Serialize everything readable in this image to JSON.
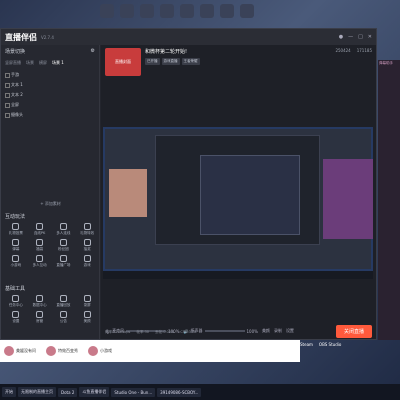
{
  "app": {
    "title": "直播伴侣",
    "version": "V2.7.4"
  },
  "sidebar": {
    "scene_header": "场景切换",
    "tabs": [
      "竖屏直播",
      "场景",
      "横屏",
      "场景 1"
    ],
    "sources": [
      "手游",
      "文本 1",
      "文本 2",
      "全屏",
      "摄像头"
    ],
    "add_source": "+ 添加素材",
    "interact_title": "互动玩法",
    "interact_items": [
      "礼物投票",
      "连线PK",
      "多人连线",
      "礼物特效",
      "弹幕",
      "福袋",
      "粉丝团",
      "抽奖",
      "小游戏",
      "多人互动",
      "直播广场",
      "游戏"
    ],
    "tools_title": "基础工具",
    "tools_items": [
      "任务中心",
      "数据中心",
      "直播回放",
      "录屏",
      "设置",
      "房管",
      "公告",
      "美颜"
    ],
    "more": "更多应用"
  },
  "room": {
    "title": "和微杯第二轮开始!",
    "thumb_text": "直播封面",
    "tags": [
      "已开播",
      "游戏直播",
      "王者荣耀"
    ],
    "stats": [
      "250424",
      "171185"
    ]
  },
  "controls": {
    "mic_label": "麦克风",
    "mic_value": "100%",
    "speaker_label": "扬声器",
    "speaker_value": "100%",
    "icons": [
      "美颜",
      "录制",
      "设置"
    ],
    "start_button": "关闭直播"
  },
  "footer": [
    "码率:2500kbps",
    "帧率:30",
    "丢帧:0.00%",
    "CPU:30%"
  ],
  "dock": {
    "items": [
      "美媛没有问",
      "特效百变秀",
      "小游戏"
    ]
  },
  "taskbar": {
    "items": [
      "开始",
      "无限制的直播主页",
      "Dota 2",
      "斗鱼直播伴侣",
      "Studio One - Bun...",
      "39149086-SCBOY..."
    ]
  },
  "tray": {
    "steam": "Steam",
    "obs": "OBS Studio"
  },
  "right_panel": {
    "title": "弹幕助手"
  }
}
